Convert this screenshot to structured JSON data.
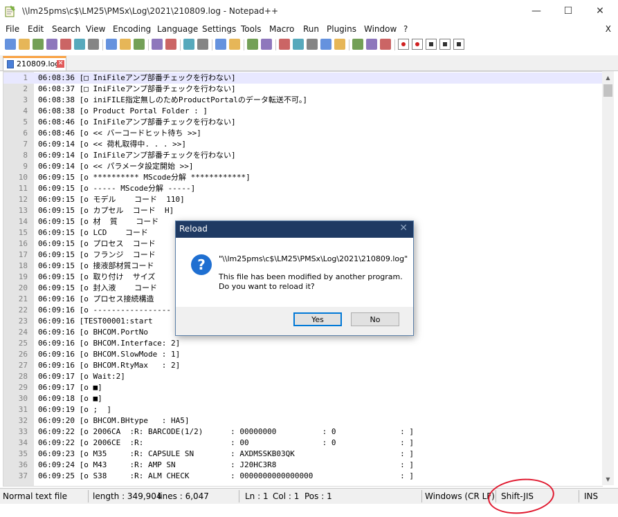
{
  "window": {
    "title": "\\\\lm25pms\\c$\\LM25\\PMSx\\Log\\2021\\210809.log - Notepad++",
    "controls": {
      "minimize": "—",
      "maximize": "☐",
      "close": "✕"
    }
  },
  "menu": {
    "items": [
      "File",
      "Edit",
      "Search",
      "View",
      "Encoding",
      "Language",
      "Settings",
      "Tools",
      "Macro",
      "Run",
      "Plugins",
      "Window",
      "?"
    ],
    "close_label": "X"
  },
  "toolbar": {
    "icons": [
      "new-file-icon",
      "open-file-icon",
      "save-icon",
      "save-all-icon",
      "close-file-icon",
      "close-all-icon",
      "print-icon",
      "cut-icon",
      "copy-icon",
      "paste-icon",
      "undo-icon",
      "redo-icon",
      "find-icon",
      "replace-icon",
      "zoom-in-icon",
      "zoom-out-icon",
      "sync-vertical-icon",
      "sync-horizontal-icon",
      "word-wrap-icon",
      "show-all-chars-icon",
      "indent-guide-icon",
      "document-map-icon",
      "function-list-icon",
      "folder-workspace-icon",
      "monitoring-icon",
      "eye-icon",
      "record-macro-icon",
      "stop-record-icon",
      "play-macro-icon",
      "run-macro-multiple-icon",
      "save-macro-icon"
    ]
  },
  "tab": {
    "label": "210809.log",
    "close_glyph": "✕"
  },
  "editor": {
    "lines": [
      {
        "n": "1",
        "text": "06:08:36 [□ IniFileアンプ部番チェックを行わない]"
      },
      {
        "n": "2",
        "text": "06:08:37 [□ IniFileアンプ部番チェックを行わない]"
      },
      {
        "n": "3",
        "text": "06:08:38 [o iniFILE指定無しのためProductPortalのデータ転送不可。]"
      },
      {
        "n": "4",
        "text": "06:08:38 [o Product Portal Folder : ]"
      },
      {
        "n": "5",
        "text": "06:08:46 [o IniFileアンプ部番チェックを行わない]"
      },
      {
        "n": "6",
        "text": "06:08:46 [o << バーコードヒット待ち >>]"
      },
      {
        "n": "7",
        "text": "06:09:14 [o << 荷札取得中. . . >>]"
      },
      {
        "n": "8",
        "text": "06:09:14 [o IniFileアンプ部番チェックを行わない]"
      },
      {
        "n": "9",
        "text": "06:09:14 [o << パラメータ設定開始 >>]"
      },
      {
        "n": "10",
        "text": "06:09:15 [o ********** MScode分解 ************]"
      },
      {
        "n": "11",
        "text": "06:09:15 [o ----- MScode分解 -----]"
      },
      {
        "n": "12",
        "text": "06:09:15 [o モデル    コード  110]"
      },
      {
        "n": "13",
        "text": "06:09:15 [o カプセル  コード  H]"
      },
      {
        "n": "14",
        "text": "06:09:15 [o 材  質    コード  "
      },
      {
        "n": "15",
        "text": "06:09:15 [o LCD    コード  "
      },
      {
        "n": "16",
        "text": "06:09:15 [o プロセス  コード  "
      },
      {
        "n": "17",
        "text": "06:09:15 [o フランジ  コード  "
      },
      {
        "n": "18",
        "text": "06:09:15 [o 接液部材質コード"
      },
      {
        "n": "19",
        "text": "06:09:15 [o 取り付け  サイズ"
      },
      {
        "n": "20",
        "text": "06:09:15 [o 封入液    コード"
      },
      {
        "n": "21",
        "text": "06:09:16 [o プロセス接続構造"
      },
      {
        "n": "22",
        "text": "06:09:16 [o -----------------"
      },
      {
        "n": "23",
        "text": "06:09:16 [TEST00001:start"
      },
      {
        "n": "24",
        "text": "06:09:16 [o BHCOM.PortNo "
      },
      {
        "n": "25",
        "text": "06:09:16 [o BHCOM.Interface: 2]"
      },
      {
        "n": "26",
        "text": "06:09:16 [o BHCOM.SlowMode : 1]"
      },
      {
        "n": "27",
        "text": "06:09:16 [o BHCOM.RtyMax   : 2]"
      },
      {
        "n": "28",
        "text": "06:09:17 [o Wait:2]"
      },
      {
        "n": "29",
        "text": "06:09:17 [o ■]"
      },
      {
        "n": "30",
        "text": "06:09:18 [o ■]"
      },
      {
        "n": "31",
        "text": "06:09:19 [o ;  ]"
      },
      {
        "n": "32",
        "text": "06:09:20 [o BHCOM.BHtype   : HA5]"
      },
      {
        "n": "33",
        "text": "06:09:22 [o 2006CA  :R: BARCODE(1/2)      : 00000000          : 0              : ]"
      },
      {
        "n": "34",
        "text": "06:09:22 [o 2006CE  :R:                   : 00                : 0              : ]"
      },
      {
        "n": "35",
        "text": "06:09:23 [o M35     :R: CAPSULE SN        : AXDMSSKB03QK                       : ]"
      },
      {
        "n": "36",
        "text": "06:09:24 [o M43     :R: AMP SN            : J20HC3R8                           : ]"
      },
      {
        "n": "37",
        "text": "06:09:25 [o S38     :R: ALM CHECK         : 0000000000000000                   : ]"
      }
    ]
  },
  "status": {
    "file_type": "Normal text file",
    "length": "length : 349,904",
    "lines": "lines : 6,047",
    "ln": "Ln : 1",
    "col": "Col : 1",
    "pos": "Pos : 1",
    "eol": "Windows (CR LF)",
    "encoding": "Shift-JIS",
    "mode": "INS"
  },
  "dialog": {
    "title": "Reload",
    "close_glyph": "✕",
    "icon_glyph": "?",
    "path": "\"\\\\lm25pms\\c$\\LM25\\PMSx\\Log\\2021\\210809.log\"",
    "line1": "This file has been modified by another program.",
    "line2": "Do you want to reload it?",
    "yes_label": "Yes",
    "no_label": "No"
  },
  "colors": {
    "dialog_title_bg": "#1f3a63",
    "accent_blue": "#0078d7",
    "annotation_red": "#e0182e",
    "tab_active_top": "#f9a03f"
  }
}
